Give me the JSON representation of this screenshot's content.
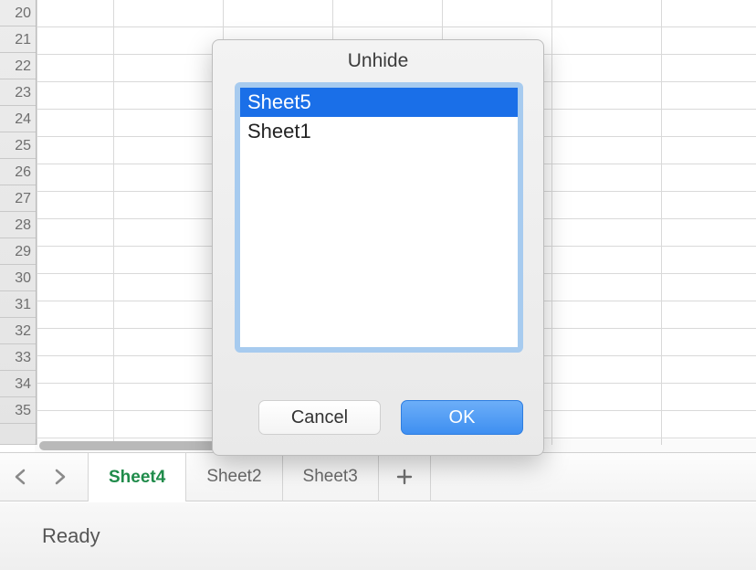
{
  "spreadsheet": {
    "row_start": 20,
    "row_end": 35
  },
  "tabs": {
    "active": "Sheet4",
    "items": [
      "Sheet4",
      "Sheet2",
      "Sheet3"
    ]
  },
  "status": {
    "text": "Ready"
  },
  "dialog": {
    "title": "Unhide",
    "items": [
      "Sheet5",
      "Sheet1"
    ],
    "selected_index": 0,
    "buttons": {
      "cancel": "Cancel",
      "ok": "OK"
    }
  }
}
